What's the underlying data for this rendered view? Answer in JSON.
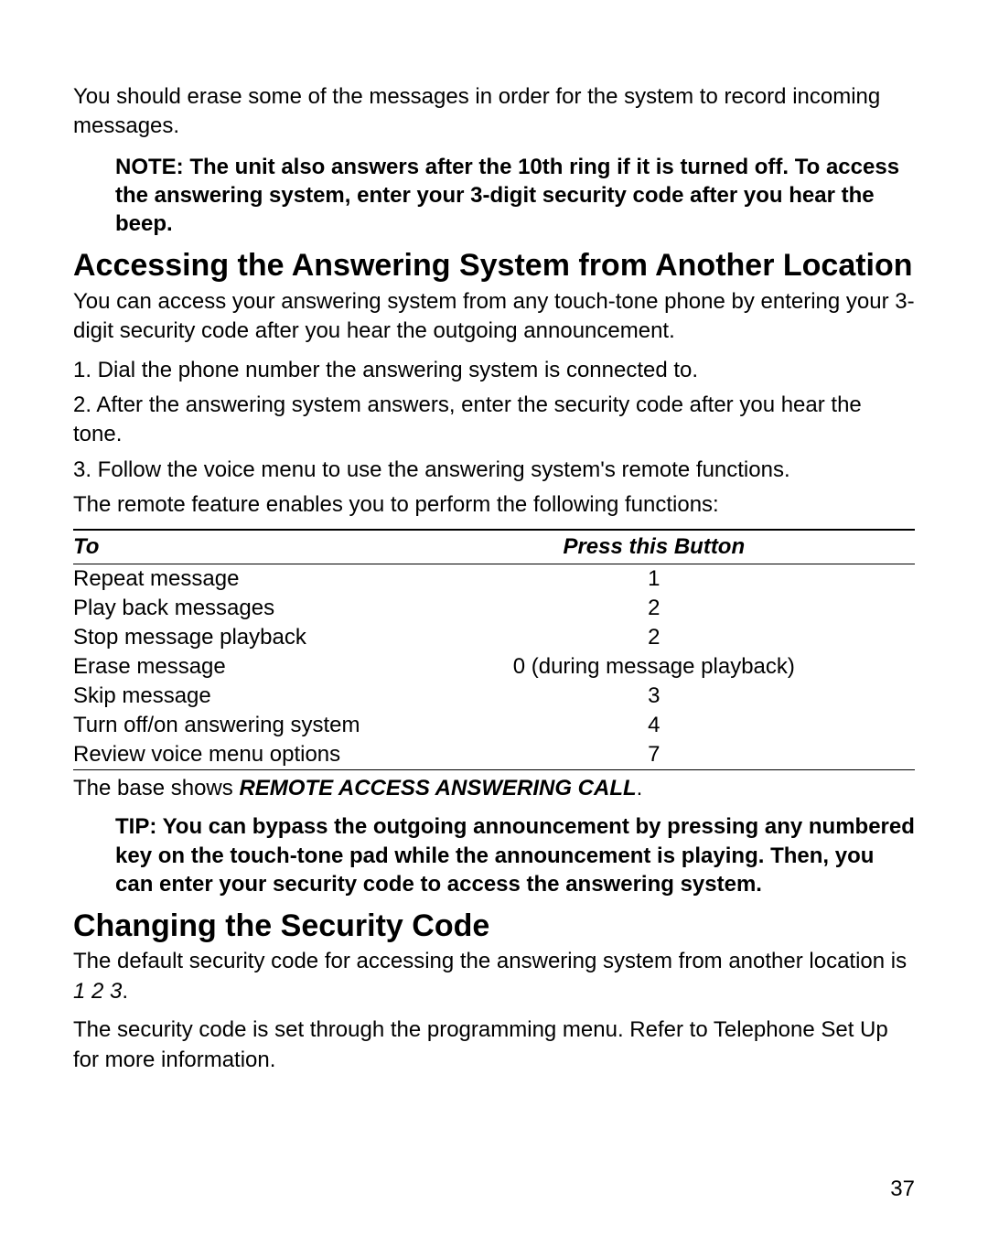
{
  "intro": "You should erase some of the messages in order for the system to record incoming messages.",
  "note": "NOTE: The unit also answers after the 10th ring if it is turned off. To access the answering system, enter your 3-digit security code after you hear the beep.",
  "section1": {
    "heading": "Accessing the Answering System from Another Location",
    "p1": "You can access your answering system from any touch-tone phone by entering your 3-digit security code after you hear the outgoing announcement.",
    "steps": [
      "1. Dial the phone number the answering system is connected to.",
      "2. After the answering system answers, enter the security code after you hear the tone.",
      "3. Follow the voice menu to use the answering system's remote functions."
    ],
    "p2": "The remote feature enables you to perform the following functions:"
  },
  "table": {
    "headers": {
      "c1": "To",
      "c2": "Press this Button"
    },
    "rows": [
      {
        "c1": "Repeat message",
        "c2": "1"
      },
      {
        "c1": "Play back messages",
        "c2": "2"
      },
      {
        "c1": "Stop message playback",
        "c2": "2"
      },
      {
        "c1": "Erase message",
        "c2": "0 (during message playback)"
      },
      {
        "c1": "Skip message",
        "c2": "3"
      },
      {
        "c1": "Turn off/on answering system",
        "c2": "4"
      },
      {
        "c1": "Review voice menu options",
        "c2": "7"
      }
    ]
  },
  "afterTable": {
    "prefix": "The base shows ",
    "bold": "REMOTE ACCESS ANSWERING CALL",
    "suffix": "."
  },
  "tip": "TIP: You can bypass the outgoing announcement by pressing any numbered key on the touch-tone pad while the announcement is playing. Then, you can enter your security code to access the answering system.",
  "section2": {
    "heading": "Changing the Security Code",
    "p1_prefix": "The default security code for accessing the answering system from another location is  ",
    "p1_code": "1 2 3",
    "p1_suffix": ".",
    "p2": "The security code is set through the programming menu. Refer to Telephone Set Up for more information."
  },
  "pageNumber": "37"
}
